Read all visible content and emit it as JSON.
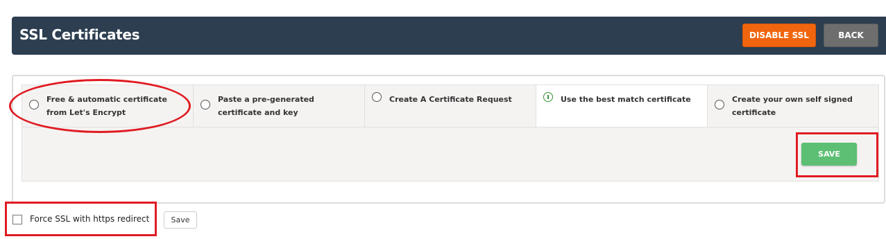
{
  "header": {
    "title": "SSL Certificates",
    "disable_ssl_label": "DISABLE SSL",
    "back_label": "BACK",
    "colors": {
      "bar": "#2c3e50",
      "disable": "#f0650e",
      "back": "#6e6e6e"
    }
  },
  "certificate_options": [
    {
      "label": "Free & automatic certificate from Let's Encrypt",
      "selected": false
    },
    {
      "label": "Paste a pre-generated certificate and key",
      "selected": false
    },
    {
      "label": "Create A Certificate Request",
      "selected": false
    },
    {
      "label": "Use the best match certificate",
      "selected": true
    },
    {
      "label": "Create your own self signed certificate",
      "selected": false
    }
  ],
  "panel": {
    "save_label": "SAVE",
    "save_color": "#5cbf73"
  },
  "force_ssl": {
    "label": "Force SSL with https redirect",
    "checked": false,
    "save_label": "Save"
  },
  "annotations": {
    "color": "#e01b22"
  }
}
